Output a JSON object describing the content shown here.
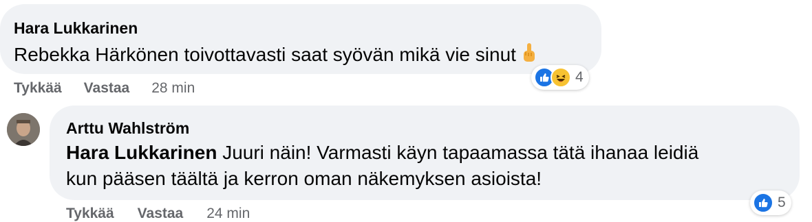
{
  "comment1": {
    "author": "Hara Lukkarinen",
    "text": "Rebekka Härkönen toivottavasti saat syövän mikä vie sinut",
    "emoji": "middle-finger-emoji",
    "reactions": {
      "icons": [
        "like",
        "haha"
      ],
      "count": "4"
    },
    "actions": {
      "like": "Tykkää",
      "reply": "Vastaa",
      "time": "28 min"
    }
  },
  "comment2": {
    "author": "Arttu Wahlström",
    "mention": "Hara Lukkarinen",
    "text_line1": "Juuri näin! Varmasti käyn tapaamassa tätä ihanaa leidiä",
    "text_line2": "kun pääsen täältä ja kerron oman näkemyksen asioista!",
    "reactions": {
      "icons": [
        "like"
      ],
      "count": "5"
    },
    "actions": {
      "like": "Tykkää",
      "reply": "Vastaa",
      "time": "24 min"
    }
  },
  "colors": {
    "bubble": "#f0f2f5",
    "like": "#1b74e4",
    "haha": "#f7c232",
    "muted": "#65676b"
  }
}
